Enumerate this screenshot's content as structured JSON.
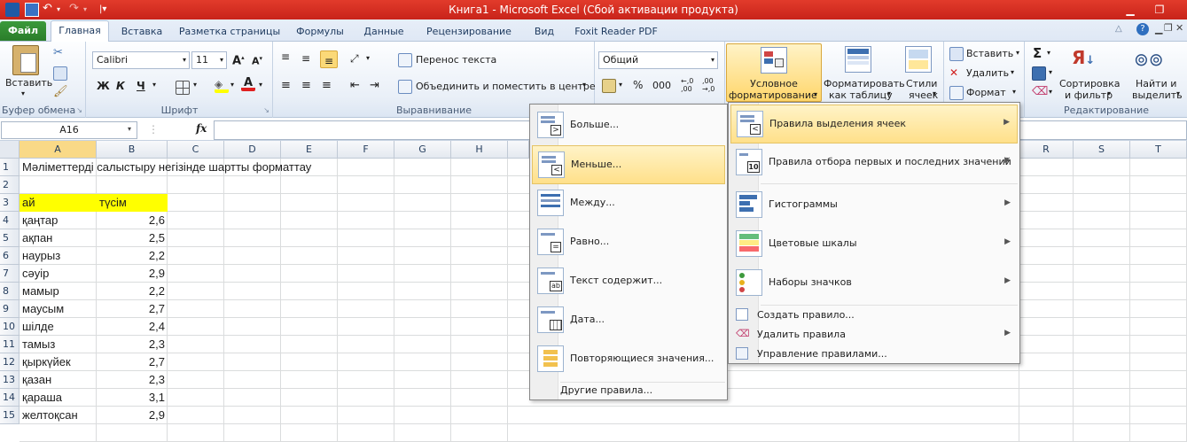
{
  "app": {
    "title": "Книга1  -  Microsoft Excel (Сбой активации продукта)"
  },
  "tabs": [
    {
      "label": "Файл"
    },
    {
      "label": "Главная"
    },
    {
      "label": "Вставка"
    },
    {
      "label": "Разметка страницы"
    },
    {
      "label": "Формулы"
    },
    {
      "label": "Данные"
    },
    {
      "label": "Рецензирование"
    },
    {
      "label": "Вид"
    },
    {
      "label": "Foxit Reader PDF"
    }
  ],
  "ribbon": {
    "clipboard": {
      "paste": "Вставить",
      "group": "Буфер обмена"
    },
    "font": {
      "name": "Calibri",
      "size": "11",
      "bold": "Ж",
      "italic": "К",
      "underline": "Ч",
      "group": "Шрифт"
    },
    "alignment": {
      "wrap": "Перенос текста",
      "merge": "Объединить и поместить в центре",
      "group": "Выравнивание"
    },
    "number": {
      "format": "Общий",
      "percent": "%",
      "thousands": "000"
    },
    "styles": {
      "cond_line1": "Условное",
      "cond_line2": "форматирование",
      "table_line1": "Форматировать",
      "table_line2": "как таблицу",
      "cell_line1": "Стили",
      "cell_line2": "ячеек"
    },
    "cells": {
      "insert": "Вставить",
      "delete": "Удалить",
      "format": "Формат"
    },
    "editing": {
      "sigma": "Σ",
      "sort_line1": "Сортировка",
      "sort_line2": "и фильтр",
      "find_line1": "Найти и",
      "find_line2": "выделить",
      "group": "Редактирование"
    }
  },
  "formula_bar": {
    "name_box": "A16",
    "fx": "fx",
    "value": ""
  },
  "columns": [
    "A",
    "B",
    "C",
    "D",
    "E",
    "F",
    "G",
    "H",
    "R",
    "S",
    "T"
  ],
  "rows": [
    {
      "num": "1",
      "a": "Мәліметтерді салыстыру негізінде шартты форматтау",
      "b": ""
    },
    {
      "num": "2",
      "a": "",
      "b": ""
    },
    {
      "num": "3",
      "a": "ай",
      "b": "түсім"
    },
    {
      "num": "4",
      "a": "қаңтар",
      "b": "2,6"
    },
    {
      "num": "5",
      "a": "ақпан",
      "b": "2,5"
    },
    {
      "num": "6",
      "a": "наурыз",
      "b": "2,2"
    },
    {
      "num": "7",
      "a": "сәуір",
      "b": "2,9"
    },
    {
      "num": "8",
      "a": "мамыр",
      "b": "2,2"
    },
    {
      "num": "9",
      "a": "маусым",
      "b": "2,7"
    },
    {
      "num": "10",
      "a": "шілде",
      "b": "2,4"
    },
    {
      "num": "11",
      "a": "тамыз",
      "b": "2,3"
    },
    {
      "num": "12",
      "a": "қыркүйек",
      "b": "2,7"
    },
    {
      "num": "13",
      "a": "қазан",
      "b": "2,3"
    },
    {
      "num": "14",
      "a": "қараша",
      "b": "3,1"
    },
    {
      "num": "15",
      "a": "желтоқсан",
      "b": "2,9"
    }
  ],
  "main_menu": {
    "items": [
      {
        "label": "Правила выделения ячеек"
      },
      {
        "label": "Правила отбора первых и последних значений"
      },
      {
        "label": "Гистограммы"
      },
      {
        "label": "Цветовые шкалы"
      },
      {
        "label": "Наборы значков"
      }
    ],
    "small_items": [
      {
        "label": "Создать правило..."
      },
      {
        "label": "Удалить правила"
      },
      {
        "label": "Управление правилами..."
      }
    ]
  },
  "sub_menu": {
    "items": [
      {
        "label": "Больше..."
      },
      {
        "label": "Меньше..."
      },
      {
        "label": "Между..."
      },
      {
        "label": "Равно..."
      },
      {
        "label": "Текст содержит..."
      },
      {
        "label": "Дата..."
      },
      {
        "label": "Повторяющиеся значения..."
      }
    ],
    "other": "Другие правила..."
  },
  "colors": {
    "title_bar": "#d1281f",
    "highlight": "#ffe08a",
    "header_fill": "#ffff00",
    "file_tab": "#2a7d2a"
  }
}
